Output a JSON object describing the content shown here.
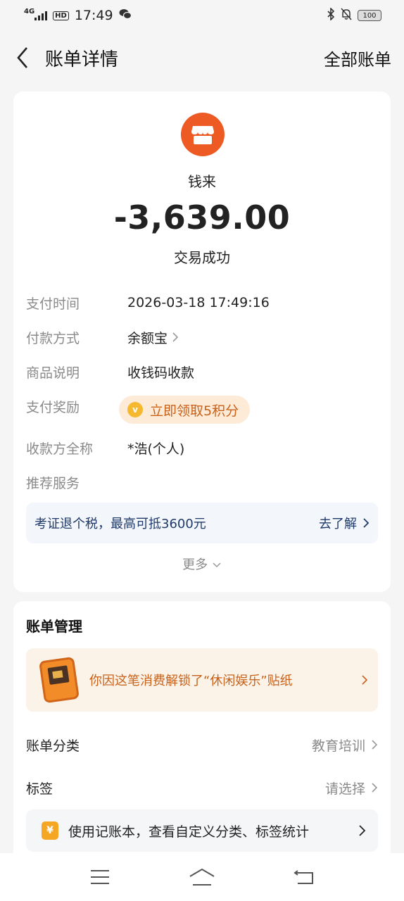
{
  "status_bar": {
    "network": "4G",
    "hd": "HD",
    "time": "17:49",
    "battery": "100"
  },
  "header": {
    "title": "账单详情",
    "right_link": "全部账单"
  },
  "transaction": {
    "merchant": "钱来",
    "amount": "-3,639.00",
    "status": "交易成功",
    "accent_color": "#ee5a24"
  },
  "details": [
    {
      "label": "支付时间",
      "value": "2026-03-18 17:49:16"
    },
    {
      "label": "付款方式",
      "value": "余额宝"
    },
    {
      "label": "商品说明",
      "value": "收钱码收款"
    },
    {
      "label": "支付奖励",
      "value": "立即领取5积分"
    },
    {
      "label": "收款方全称",
      "value": "*浩(个人)"
    },
    {
      "label": "推荐服务",
      "value": ""
    }
  ],
  "tax_banner": {
    "text": "考证退个税，最高可抵3600元",
    "link": "去了解"
  },
  "more_label": "更多",
  "management": {
    "title": "账单管理",
    "sticker_text": "你因这笔消费解锁了“休闲娱乐”贴纸",
    "category_label": "账单分类",
    "category_value": "教育培训",
    "tag_label": "标签",
    "tag_value": "请选择",
    "bookkeeping_text": "使用记账本，查看自定义分类、标签统计",
    "bookkeeping_icon": "¥"
  }
}
